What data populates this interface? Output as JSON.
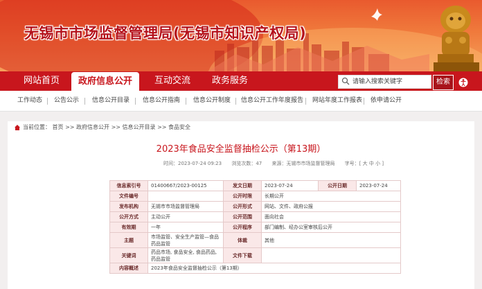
{
  "header": {
    "site_title": "无锡市市场监督管理局(无锡市知识产权局)"
  },
  "nav": {
    "items": [
      {
        "label": "网站首页"
      },
      {
        "label": "政府信息公开",
        "active": true
      },
      {
        "label": "互动交流"
      },
      {
        "label": "政务服务"
      }
    ],
    "search_placeholder": "请输入搜索关键字",
    "search_button": "检索"
  },
  "subnav": {
    "items": [
      "工作动态",
      "公告公示",
      "信息公开目录",
      "信息公开指南",
      "信息公开制度",
      "信息公开工作年度报告",
      "网站年度工作报表",
      "依申请公开"
    ]
  },
  "breadcrumb": {
    "text": "当前位置： 首页 >> 政府信息公开 >> 信息公开目录 >> 食品安全"
  },
  "article": {
    "title": "2023年食品安全监督抽检公示（第13期）",
    "meta": {
      "time": "时间：2023-07-24 09:23",
      "views": "浏览次数：47",
      "source": "来源：无锡市市场监督管理局",
      "font": "字号：[ 大 中 小 ]"
    }
  },
  "info_table": {
    "row1": {
      "l1": "信息索引号",
      "v1": "01400667/2023-00125",
      "l2": "发文日期",
      "v2": "2023-07-24",
      "l3": "公开日期",
      "v3": "2023-07-24"
    },
    "row2": {
      "l1": "文件编号",
      "v1": "",
      "l2": "公开时限",
      "v2": "长期公开"
    },
    "row3": {
      "l1": "发布机构",
      "v1": "无锡市市场监督管理局",
      "l2": "公开形式",
      "v2": "网站、文件、政府公报"
    },
    "row4": {
      "l1": "公开方式",
      "v1": "主动公开",
      "l2": "公开范围",
      "v2": "面向社会"
    },
    "row5": {
      "l1": "有效期",
      "v1": "一年",
      "l2": "公开程序",
      "v2": "部门编制、经办公室审核后公开"
    },
    "row6": {
      "l1": "主题",
      "v1": "市场监管、安全生产监管—食品药品监管",
      "l2": "体裁",
      "v2": "其他"
    },
    "row7": {
      "l1": "关键词",
      "v1": "药品市场, 食品安全, 食品药品, 药品监管",
      "l2": "文件下载",
      "v2": ""
    },
    "row8": {
      "l1": "内容概述",
      "v1": "2023年食品安全监督抽检公示（第13期）"
    }
  },
  "colors": {
    "brand_red": "#c8161d",
    "banner_orange": "#f07a3c",
    "label_bg": "#fae8e8"
  },
  "icons": [
    "search-icon",
    "home-icon",
    "accessibility-icon",
    "lion-statue-icon",
    "dove-icon",
    "skyline-icon"
  ]
}
